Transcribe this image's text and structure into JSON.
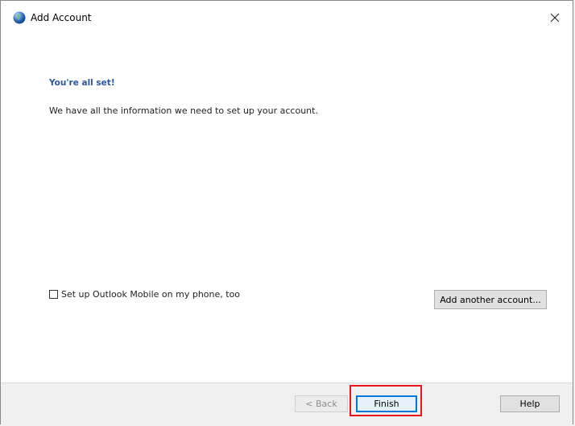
{
  "window": {
    "title": "Add Account",
    "app_icon": "outlook-globe-icon",
    "close_icon": "close-icon"
  },
  "content": {
    "heading": "You're all set!",
    "message": "We have all the information we need to set up your account.",
    "mobile_checkbox_label": "Set up Outlook Mobile on my phone, too",
    "mobile_checkbox_checked": false,
    "add_another_label": "Add another account..."
  },
  "footer": {
    "back_label": "< Back",
    "finish_label": "Finish",
    "help_label": "Help"
  },
  "colors": {
    "heading": "#2b579a",
    "highlight": "#e8141b",
    "focus": "#0078d7"
  }
}
